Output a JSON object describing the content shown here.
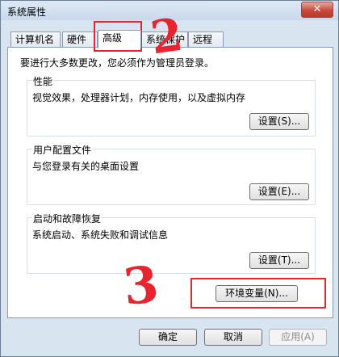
{
  "window": {
    "title": "系统属性",
    "close_glyph": "✕"
  },
  "tabs": [
    {
      "label": "计算机名"
    },
    {
      "label": "硬件"
    },
    {
      "label": "高级"
    },
    {
      "label": "系统保护"
    },
    {
      "label": "远程"
    }
  ],
  "advanced": {
    "note": "要进行大多数更改，您必须作为管理员登录。",
    "performance": {
      "title": "性能",
      "desc": "视觉效果，处理器计划，内存使用，以及虚拟内存",
      "button": "设置(S)..."
    },
    "user_profiles": {
      "title": "用户配置文件",
      "desc": "与您登录有关的桌面设置",
      "button": "设置(E)..."
    },
    "startup_recovery": {
      "title": "启动和故障恢复",
      "desc": "系统启动、系统失败和调试信息",
      "button": "设置(T)..."
    },
    "env_button": "环境变量(N)..."
  },
  "footer": {
    "ok": "确定",
    "cancel": "取消",
    "apply": "应用(A)"
  },
  "annotations": {
    "num2": "2",
    "num3": "3",
    "color": "#e8252e"
  }
}
